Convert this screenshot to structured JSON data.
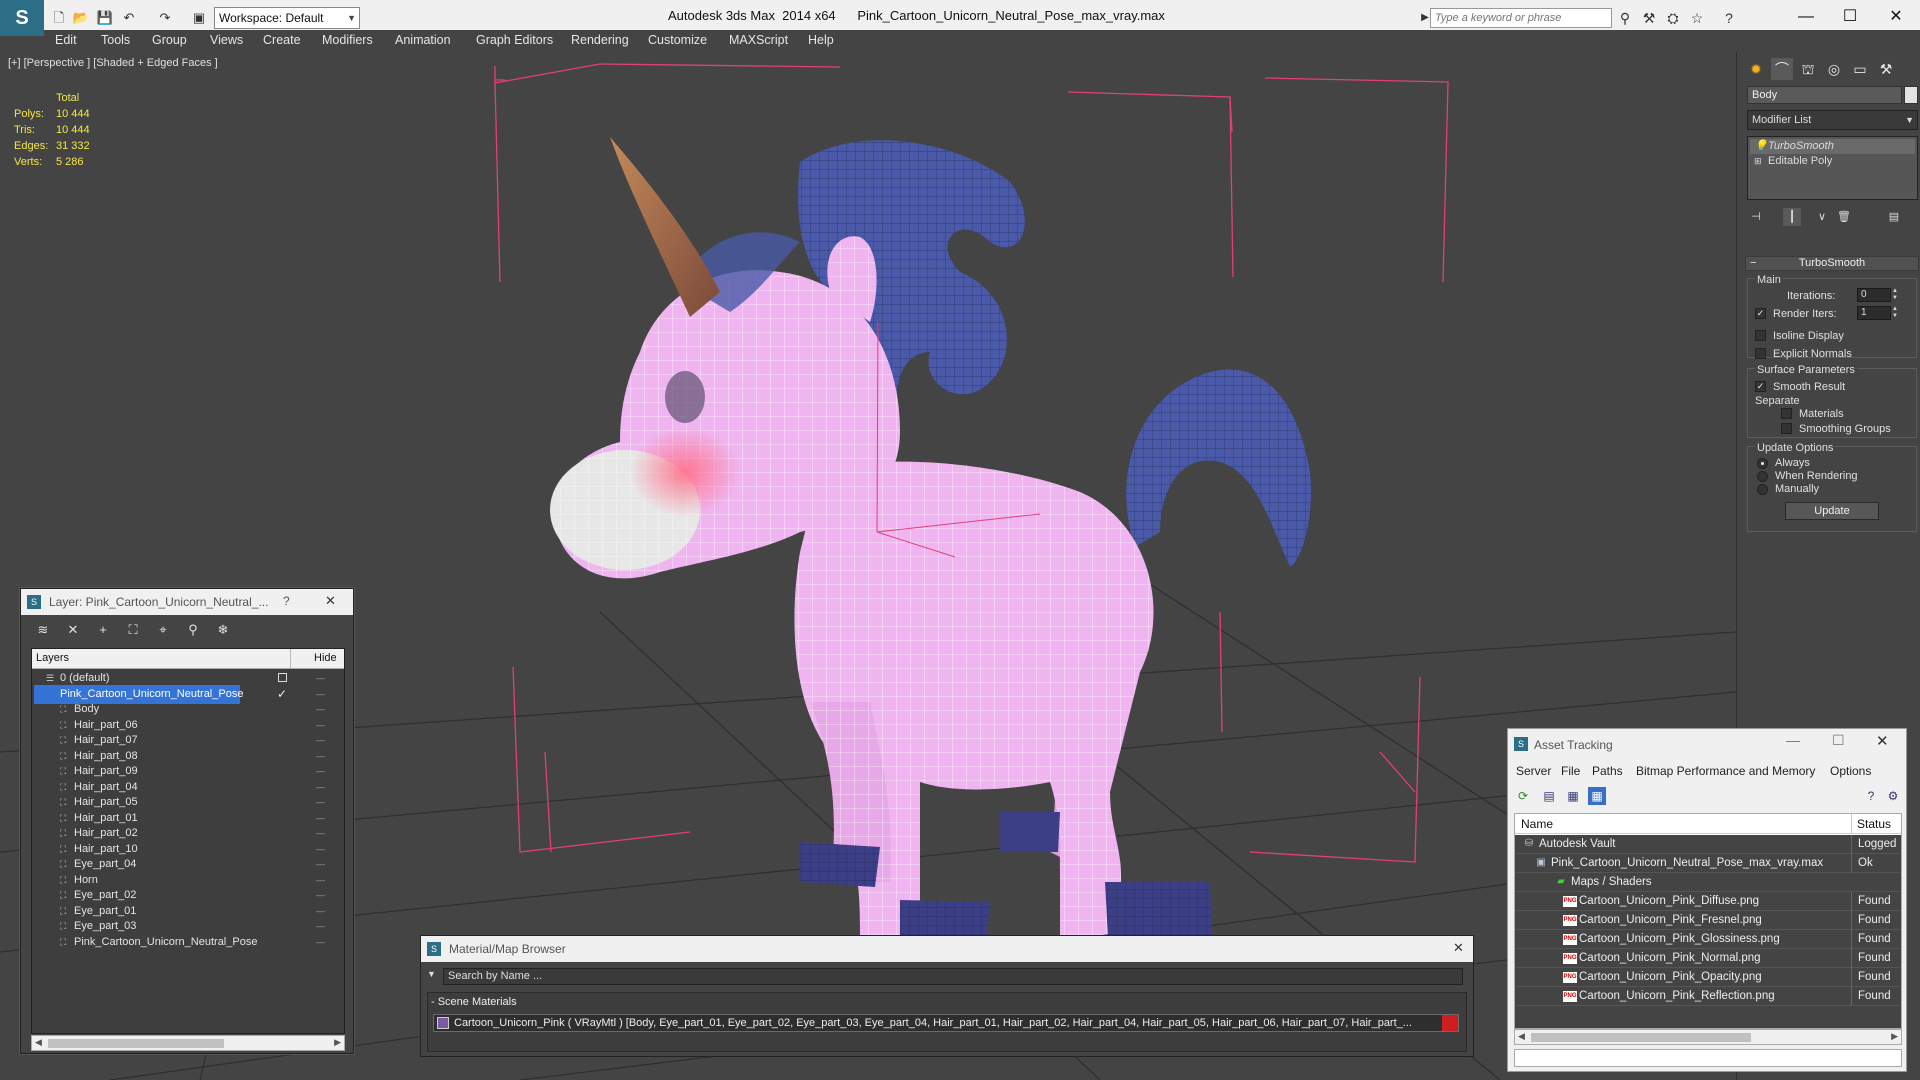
{
  "window": {
    "title": "Autodesk 3ds Max  2014 x64      Pink_Cartoon_Unicorn_Neutral_Pose_max_vray.max",
    "workspace": "Workspace: Default",
    "search_placeholder": "Type a keyword or phrase",
    "logo": "S"
  },
  "menubar": [
    "Edit",
    "Tools",
    "Group",
    "Views",
    "Create",
    "Modifiers",
    "Animation",
    "Graph Editors",
    "Rendering",
    "Customize",
    "MAXScript",
    "Help"
  ],
  "viewport": {
    "label": "[+] [Perspective ] [Shaded + Edged Faces ]",
    "stats": {
      "header": "Total",
      "polys_label": "Polys:",
      "polys": "10 444",
      "tris_label": "Tris:",
      "tris": "10 444",
      "edges_label": "Edges:",
      "edges": "31 332",
      "verts_label": "Verts:",
      "verts": "5 286"
    },
    "colors": {
      "body": "#f0b4f0",
      "mane": "#4a5aa8",
      "horn": "#b06a45",
      "bbox": "#e0407a"
    }
  },
  "command_panel": {
    "object_name": "Body",
    "modifier_list": "Modifier List",
    "stack": [
      "TurboSmooth",
      "Editable Poly"
    ],
    "rollout": "TurboSmooth",
    "main_group": "Main",
    "iterations_label": "Iterations:",
    "iterations": "0",
    "render_iters_label": "Render Iters:",
    "render_iters": "1",
    "isoline": "Isoline Display",
    "explicit_normals": "Explicit Normals",
    "surface_group": "Surface Parameters",
    "smooth_result": "Smooth Result",
    "separate": "Separate",
    "materials": "Materials",
    "smoothing_groups": "Smoothing Groups",
    "update_group": "Update Options",
    "always": "Always",
    "when_rendering": "When Rendering",
    "manually": "Manually",
    "update_btn": "Update"
  },
  "layer_dialog": {
    "title": "Layer: Pink_Cartoon_Unicorn_Neutral_...",
    "help": "?",
    "close": "✕",
    "col_layers": "Layers",
    "col_hide": "Hide",
    "rows": [
      {
        "name": "0 (default)"
      },
      {
        "name": "Pink_Cartoon_Unicorn_Neutral_Pose"
      },
      {
        "name": "Body"
      },
      {
        "name": "Hair_part_06"
      },
      {
        "name": "Hair_part_07"
      },
      {
        "name": "Hair_part_08"
      },
      {
        "name": "Hair_part_09"
      },
      {
        "name": "Hair_part_04"
      },
      {
        "name": "Hair_part_05"
      },
      {
        "name": "Hair_part_01"
      },
      {
        "name": "Hair_part_02"
      },
      {
        "name": "Hair_part_10"
      },
      {
        "name": "Eye_part_04"
      },
      {
        "name": "Horn"
      },
      {
        "name": "Eye_part_02"
      },
      {
        "name": "Eye_part_01"
      },
      {
        "name": "Eye_part_03"
      },
      {
        "name": "Pink_Cartoon_Unicorn_Neutral_Pose"
      }
    ]
  },
  "material_browser": {
    "title": "Material/Map Browser",
    "close": "✕",
    "search": "Search by Name ...",
    "section": "- Scene Materials",
    "row": "Cartoon_Unicorn_Pink  ( VRayMtl )  [Body, Eye_part_01, Eye_part_02, Eye_part_03, Eye_part_04, Hair_part_01, Hair_part_02, Hair_part_04, Hair_part_05, Hair_part_06, Hair_part_07, Hair_part_..."
  },
  "asset_tracking": {
    "title": "Asset Tracking",
    "menu": [
      "Server",
      "File",
      "Paths",
      "Bitmap Performance and Memory",
      "Options"
    ],
    "col_name": "Name",
    "col_status": "Status",
    "rows": [
      {
        "name": "Autodesk Vault",
        "status": "Logged"
      },
      {
        "name": "Pink_Cartoon_Unicorn_Neutral_Pose_max_vray.max",
        "status": "Ok"
      },
      {
        "name": "Maps / Shaders",
        "status": ""
      },
      {
        "name": "Cartoon_Unicorn_Pink_Diffuse.png",
        "status": "Found"
      },
      {
        "name": "Cartoon_Unicorn_Pink_Fresnel.png",
        "status": "Found"
      },
      {
        "name": "Cartoon_Unicorn_Pink_Glossiness.png",
        "status": "Found"
      },
      {
        "name": "Cartoon_Unicorn_Pink_Normal.png",
        "status": "Found"
      },
      {
        "name": "Cartoon_Unicorn_Pink_Opacity.png",
        "status": "Found"
      },
      {
        "name": "Cartoon_Unicorn_Pink_Reflection.png",
        "status": "Found"
      }
    ]
  }
}
